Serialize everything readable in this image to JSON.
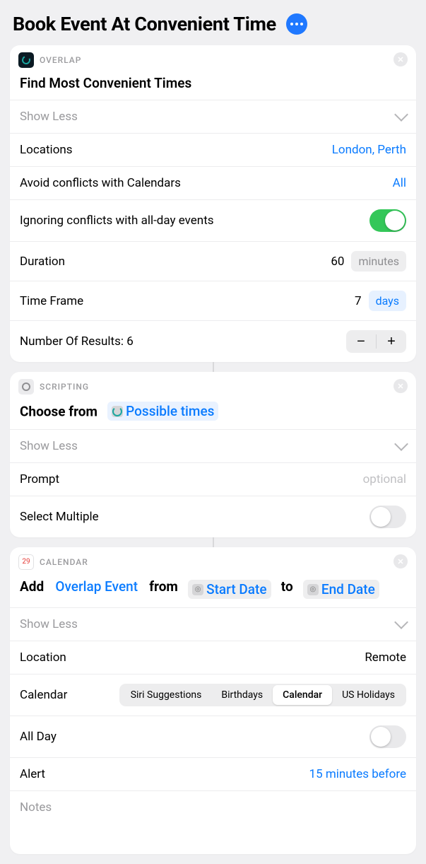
{
  "header": {
    "title": "Book Event At Convenient Time"
  },
  "cards": {
    "overlap": {
      "app": "OVERLAP",
      "title": "Find Most Convenient Times",
      "show_less": "Show Less",
      "rows": {
        "locations": {
          "label": "Locations",
          "value": "London, Perth"
        },
        "avoid": {
          "label": "Avoid conflicts with Calendars",
          "value": "All"
        },
        "ignore": {
          "label": "Ignoring conflicts with all-day events",
          "on": true
        },
        "duration": {
          "label": "Duration",
          "value": "60",
          "unit": "minutes"
        },
        "timeframe": {
          "label": "Time Frame",
          "value": "7",
          "unit": "days"
        },
        "results": {
          "label": "Number Of Results: 6"
        }
      }
    },
    "scripting": {
      "app": "SCRIPTING",
      "title_prefix": "Choose from",
      "token": "Possible times",
      "show_less": "Show Less",
      "rows": {
        "prompt": {
          "label": "Prompt",
          "placeholder": "optional"
        },
        "multiple": {
          "label": "Select Multiple",
          "on": false
        }
      }
    },
    "calendar": {
      "app": "CALENDAR",
      "day_number": "29",
      "title": {
        "t1": "Add",
        "token1": "Overlap Event",
        "t2": "from",
        "token2": "Start Date",
        "t3": "to",
        "token3": "End Date"
      },
      "show_less": "Show Less",
      "rows": {
        "location": {
          "label": "Location",
          "value": "Remote"
        },
        "calendar_label": "Calendar",
        "calendars": [
          "Siri Suggestions",
          "Birthdays",
          "Calendar",
          "US Holidays"
        ],
        "calendars_selected": "Calendar",
        "allday": {
          "label": "All Day",
          "on": false
        },
        "alert": {
          "label": "Alert",
          "value": "15 minutes before"
        },
        "notes_placeholder": "Notes"
      }
    }
  }
}
